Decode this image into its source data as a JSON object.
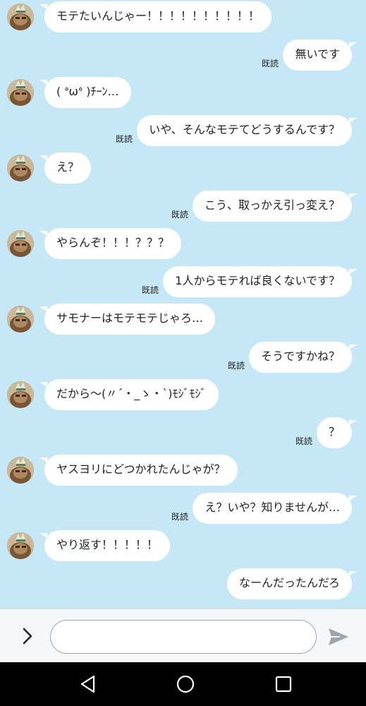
{
  "read_label": "既読",
  "messages": [
    {
      "dir": "in",
      "text": "モテたいんじゃー！！！！！！！！！！"
    },
    {
      "dir": "out",
      "text": "無いです",
      "read": true
    },
    {
      "dir": "in",
      "text": "( ᐤωᐤ )ﾁｰﾝ…"
    },
    {
      "dir": "out",
      "text": "いや、そんなモテてどうするんです？",
      "read": true
    },
    {
      "dir": "in",
      "text": "え？"
    },
    {
      "dir": "out",
      "text": "こう、取っかえ引っ変え？",
      "read": true
    },
    {
      "dir": "in",
      "text": "やらんぞ！！！？？？"
    },
    {
      "dir": "out",
      "text": "1人からモテれば良くないです？",
      "read": true
    },
    {
      "dir": "in",
      "text": "サモナーはモテモテじゃろ…"
    },
    {
      "dir": "out",
      "text": "そうですかね？",
      "read": true
    },
    {
      "dir": "in",
      "text": "だから〜(〃´・_ゝ・`)ﾓｼﾞﾓｼﾞ"
    },
    {
      "dir": "out",
      "text": "？",
      "read": true
    },
    {
      "dir": "in",
      "text": "ヤスヨリにどつかれたんじゃが？"
    },
    {
      "dir": "out",
      "text": "え？いや？知りませんが…",
      "read": true
    },
    {
      "dir": "in",
      "text": "やり返す！！！！！"
    },
    {
      "dir": "out",
      "text": "なーんだったんだろ",
      "read": false
    }
  ],
  "composer": {
    "placeholder": "",
    "expand_icon": "chevron-right-icon",
    "send_icon": "send-icon"
  },
  "navbar": {
    "back_icon": "back-triangle-icon",
    "home_icon": "home-circle-icon",
    "recents_icon": "recents-square-icon"
  },
  "colors": {
    "chat_background": "#c6e8f6",
    "bubble": "#ffffff",
    "composer_background": "#f5f7f8",
    "navbar": "#000000"
  }
}
